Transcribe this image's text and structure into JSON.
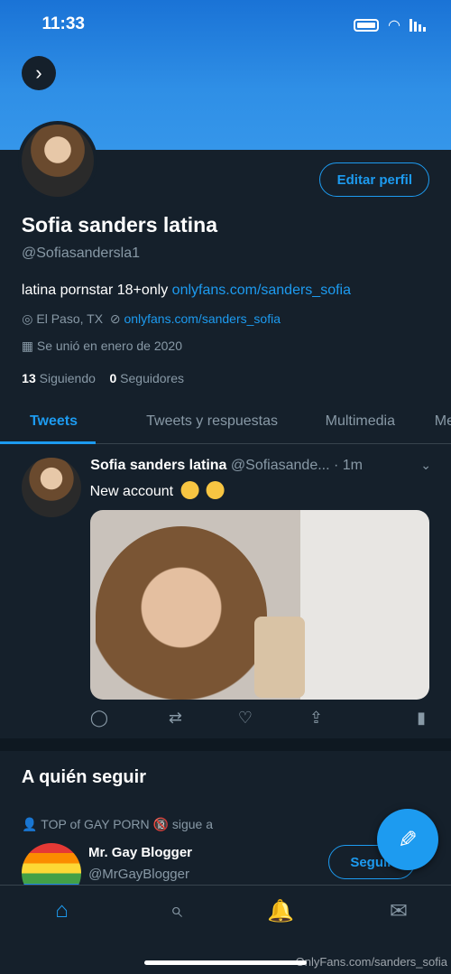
{
  "status": {
    "time": "11:33"
  },
  "profile": {
    "name": "Sofia sanders latina",
    "handle": "@Sofiasandersla1",
    "edit_label": "Editar perfil",
    "bio_text": "latina pornstar 18+only",
    "bio_link": "onlyfans.com/sanders_sofia",
    "location": "El Paso, TX",
    "website": "onlyfans.com/sanders_sofia",
    "joined": "Se unió en enero de 2020",
    "following_count": "13",
    "following_label": "Siguiendo",
    "followers_count": "0",
    "followers_label": "Seguidores"
  },
  "tabs": [
    {
      "label": "Tweets"
    },
    {
      "label": "Tweets y respuestas"
    },
    {
      "label": "Multimedia"
    },
    {
      "label": "Me"
    }
  ],
  "tweet": {
    "name": "Sofia sanders latina",
    "handle_time": "@Sofiasande... · 1m",
    "text": "New account"
  },
  "who_to_follow": {
    "title": "A quién seguir",
    "context": "TOP of GAY PORN 🔞 sigue a",
    "name": "Mr. Gay Blogger",
    "handle": "@MrGayBlogger",
    "follow_label": "Seguir"
  },
  "watermark": "OnlyFans.com/sanders_sofia",
  "colors": {
    "accent": "#1d9bf0",
    "background": "#15202b",
    "muted": "#8899a6"
  }
}
